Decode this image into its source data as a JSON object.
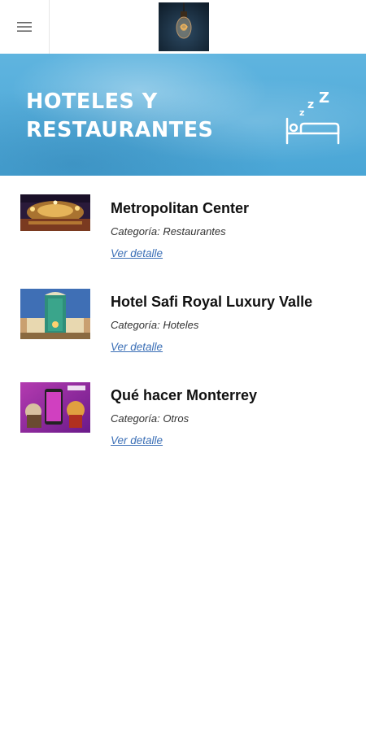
{
  "header": {
    "menu_icon": "hamburger-menu-icon",
    "logo_icon": "lightbulb-logo"
  },
  "banner": {
    "title": "HOTELES Y\nRESTAURANTES",
    "icon": "bed-sleep-icon",
    "color": "#55ade0"
  },
  "items": [
    {
      "title": "Metropolitan Center",
      "category": "Categoría: Restaurantes",
      "link": "Ver detalle"
    },
    {
      "title": "Hotel Safi Royal Luxury Valle",
      "category": "Categoría: Hoteles",
      "link": "Ver detalle"
    },
    {
      "title": "Qué hacer Monterrey",
      "category": "Categoría: Otros",
      "link": "Ver detalle"
    }
  ],
  "colors": {
    "link": "#3b6fb6",
    "banner": "#55ade0"
  }
}
